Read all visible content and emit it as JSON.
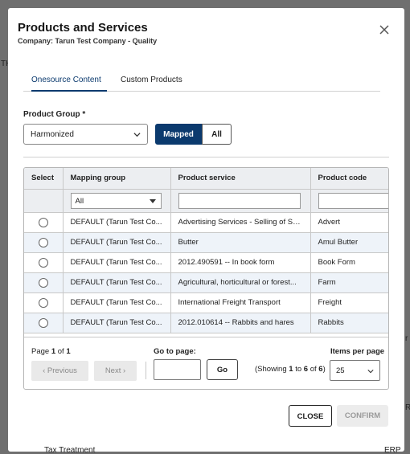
{
  "background": {
    "left_fragment": "TH",
    "bottom_left_text": "Tax Treatment",
    "bottom_right_text": "ERP Qu",
    "right_fragment_1": "r",
    "right_fragment_2": "R"
  },
  "modal": {
    "title": "Products and Services",
    "subtitle": "Company: Tarun Test Company - Quality"
  },
  "tabs": [
    {
      "label": "Onesource Content",
      "active": true
    },
    {
      "label": "Custom Products",
      "active": false
    }
  ],
  "filters": {
    "product_group_label": "Product Group *",
    "product_group_value": "Harmonized",
    "toggle_mapped": "Mapped",
    "toggle_all": "All"
  },
  "grid": {
    "columns": [
      "Select",
      "Mapping group",
      "Product service",
      "Product code"
    ],
    "filter_mapping_value": "All",
    "rows": [
      {
        "mapping_group": "DEFAULT (Tarun Test Co...",
        "product_service": "Advertising Services - Selling of Sp...",
        "product_code": "Advert"
      },
      {
        "mapping_group": "DEFAULT (Tarun Test Co...",
        "product_service": "Butter",
        "product_code": "Amul Butter"
      },
      {
        "mapping_group": "DEFAULT (Tarun Test Co...",
        "product_service": "2012.490591 -- In book form",
        "product_code": "Book Form"
      },
      {
        "mapping_group": "DEFAULT (Tarun Test Co...",
        "product_service": "Agricultural, horticultural or forest...",
        "product_code": "Farm"
      },
      {
        "mapping_group": "DEFAULT (Tarun Test Co...",
        "product_service": "International Freight Transport",
        "product_code": "Freight"
      },
      {
        "mapping_group": "DEFAULT (Tarun Test Co...",
        "product_service": "2012.010614 -- Rabbits and hares",
        "product_code": "Rabbits"
      }
    ]
  },
  "pager": {
    "page_prefix": "Page",
    "page_current": "1",
    "page_of": "of",
    "page_total": "1",
    "previous": "Previous",
    "next": "Next",
    "goto_label": "Go to page:",
    "go_button": "Go",
    "showing_open": "(Showing",
    "showing_from": "1",
    "showing_to_word": "to",
    "showing_to": "6",
    "showing_of_word": "of",
    "showing_total": "6",
    "showing_close": ")",
    "items_per_page_label": "Items per page",
    "items_per_page_value": "25"
  },
  "actions": {
    "close": "CLOSE",
    "confirm": "CONFIRM"
  },
  "colors": {
    "accent": "#0b3a6e",
    "row_alt": "#eef3f9",
    "header_bg": "#eceef1"
  }
}
